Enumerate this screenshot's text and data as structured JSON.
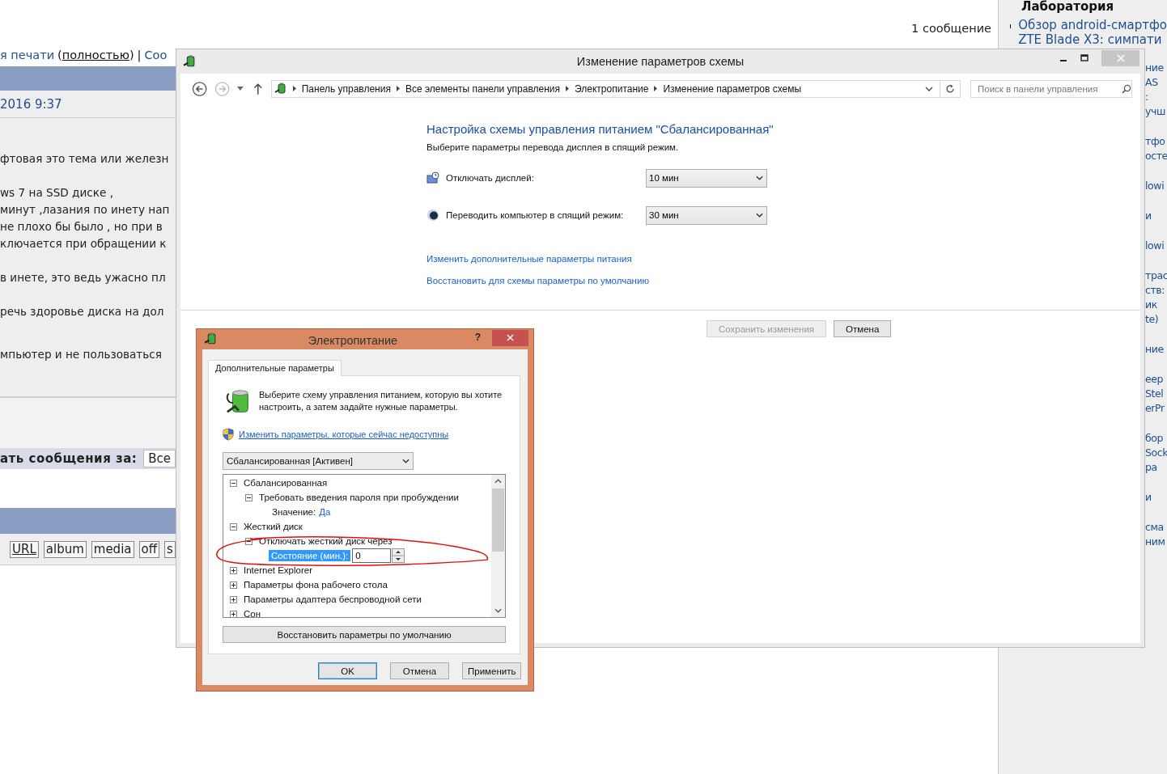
{
  "forum": {
    "top_line": [
      {
        "text": "я печати",
        "kind": "link"
      },
      {
        "text": "(",
        "kind": "plain"
      },
      {
        "text": "полностью",
        "kind": "underlined"
      },
      {
        "text": ")",
        "kind": "plain"
      },
      {
        "text": "|",
        "kind": "plain"
      },
      {
        "text": "Соо",
        "kind": "link"
      }
    ],
    "message_count": "1 сообщение",
    "post_date": "2016 9:37",
    "post_paragraphs": [
      [
        "фтовая это тема или железн"
      ],
      [
        "ws 7 на SSD диске ,",
        "минут ,лазания по инету нап",
        "не плохо бы было , но при в",
        "ключается при обращении к"
      ],
      [
        "в инете, это ведь ужасно пл"
      ],
      [
        "речь здоровье диска на дол"
      ],
      [
        "мпьютер и не пользоваться"
      ]
    ],
    "filter_label": "ать сообщения за:",
    "filter_value": "Все",
    "bbcode_buttons": [
      {
        "label": "URL",
        "underlined": true
      },
      {
        "label": "album",
        "underlined": false
      },
      {
        "label": "media",
        "underlined": false
      },
      {
        "label": "off",
        "underlined": false
      },
      {
        "label": "s",
        "underlined": false
      }
    ]
  },
  "sidebar": {
    "title": "Лаборатория",
    "first_item": [
      "Обзор android-смартфо",
      "ZTE Blade X3: симпати"
    ],
    "fragments": [
      [
        "ние",
        "AS",
        ":",
        "учш"
      ],
      [
        "тфо",
        "осте"
      ],
      [
        "lowi"
      ],
      [
        "и"
      ],
      [
        "lowi"
      ],
      [
        "трас",
        "ств:",
        "ик",
        "te)"
      ],
      [
        "ние"
      ],
      [
        "еер",
        "Stel",
        "erPr"
      ],
      [
        "бор",
        "Sock",
        "ра"
      ],
      [
        "и"
      ],
      [
        "сма",
        "ним"
      ]
    ]
  },
  "main_window": {
    "title": "Изменение параметров схемы",
    "breadcrumbs": [
      "Панель управления",
      "Все элементы панели управления",
      "Электропитание",
      "Изменение параметров схемы"
    ],
    "search": {
      "placeholder": "Поиск в панели управления"
    },
    "heading": "Настройка схемы управления питанием \"Сбалансированная\"",
    "subheading": "Выберите параметры перевода дисплея в спящий режим.",
    "settings": [
      {
        "kind": "display",
        "label": "Отключать дисплей:",
        "value": "10 мин"
      },
      {
        "kind": "sleep",
        "label": "Переводить компьютер в спящий режим:",
        "value": "30 мин"
      }
    ],
    "links": [
      "Изменить дополнительные параметры питания",
      "Восстановить для схемы параметры по умолчанию"
    ],
    "buttons": [
      {
        "label": "Сохранить изменения",
        "disabled": true
      },
      {
        "label": "Отмена",
        "disabled": false
      }
    ]
  },
  "power_dialog": {
    "title": "Электропитание",
    "help": "?",
    "tabs": [
      {
        "label": "Дополнительные параметры",
        "selected": true
      }
    ],
    "intro": "Выберите схему управления питанием, которую вы хотите настроить, а затем задайте нужные параметры.",
    "admin_link": "Изменить параметры, которые сейчас недоступны",
    "plan": "Сбалансированная [Активен]",
    "tree": [
      {
        "label": "Сбалансированная",
        "expanded": true,
        "children": [
          {
            "label": "Требовать введения пароля при пробуждении",
            "expanded": true,
            "children": [
              {
                "kind": "value",
                "label": "Значение:",
                "value": "Да"
              }
            ]
          }
        ]
      },
      {
        "label": "Жесткий диск",
        "expanded": true,
        "children": [
          {
            "label": "Отключать жесткий диск через",
            "expanded": true,
            "children": [
              {
                "kind": "spin",
                "label": "Состояние (мин.):",
                "value": "0"
              }
            ]
          }
        ]
      },
      {
        "label": "Internet Explorer",
        "expanded": false
      },
      {
        "label": "Параметры фона рабочего стола",
        "expanded": false
      },
      {
        "label": "Параметры адаптера беспроводной сети",
        "expanded": false
      },
      {
        "label": "Сон",
        "expanded": false
      }
    ],
    "restore_button": "Восстановить параметры по умолчанию",
    "buttons": [
      {
        "label": "OK",
        "default": true
      },
      {
        "label": "Отмена",
        "default": false
      },
      {
        "label": "Применить",
        "default": false
      }
    ]
  }
}
